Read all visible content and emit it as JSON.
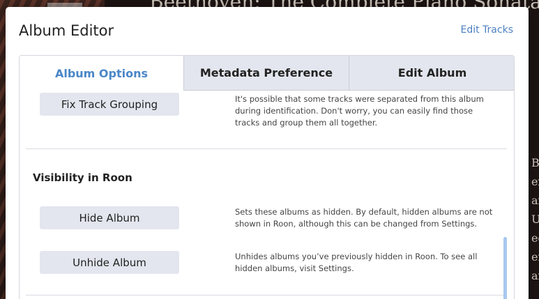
{
  "background": {
    "album_title": "Beethoven: The Complete Piano Sonatas",
    "side_text": [
      "B",
      "ex",
      "ar",
      "U",
      "ed",
      "er",
      "ar"
    ]
  },
  "modal": {
    "title": "Album Editor",
    "edit_tracks_link": "Edit Tracks",
    "tabs": [
      {
        "label": "Album Options",
        "active": true
      },
      {
        "label": "Metadata Preference",
        "active": false
      },
      {
        "label": "Edit Album",
        "active": false
      }
    ],
    "fix_track_grouping": {
      "button_label": "Fix Track Grouping",
      "description": "It's possible that some tracks were separated from this album during identification. Don't worry, you can easily find those tracks and group them all together."
    },
    "visibility_section": {
      "heading": "Visibility in Roon",
      "hide": {
        "button_label": "Hide Album",
        "description": "Sets these albums as hidden. By default, hidden albums are not shown in Roon, although this can be changed from Settings."
      },
      "unhide": {
        "button_label": "Unhide Album",
        "description": "Unhides albums you’ve previously hidden in Roon. To see all hidden albums, visit Settings."
      }
    }
  },
  "colors": {
    "accent": "#4a86c8",
    "link": "#4a7fc2",
    "button_bg": "#e3e6ee",
    "scrollbar": "#a9c8ef"
  }
}
